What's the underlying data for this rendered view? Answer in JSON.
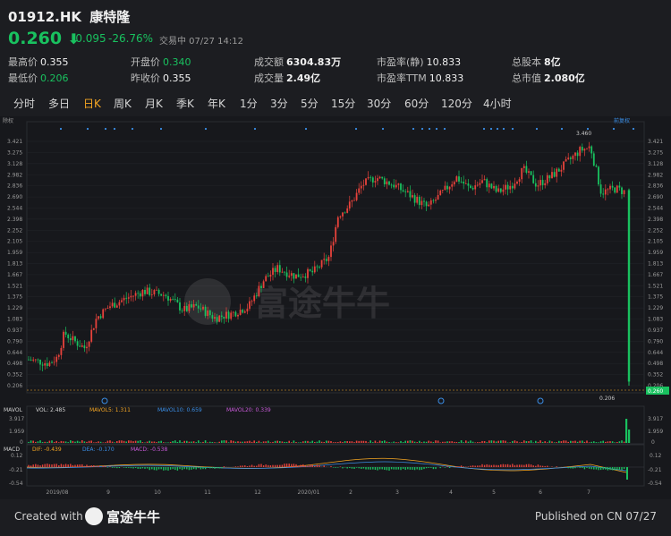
{
  "header": {
    "symbol": "01912.HK",
    "name": "康特隆",
    "price": "0.260",
    "change": "-0.095",
    "change_pct": "-26.76%",
    "status": "交易中 07/27 14:12",
    "colors": {
      "down": "#19c15f",
      "up": "#e8423b",
      "accent": "#f5a623"
    }
  },
  "stats": [
    {
      "label": "最高价",
      "value": "0.355"
    },
    {
      "label": "开盘价",
      "value": "0.340"
    },
    {
      "label": "成交额",
      "value": "6304.83万"
    },
    {
      "label": "市盈率(静)",
      "value": "10.833"
    },
    {
      "label": "总股本",
      "value": "8亿"
    },
    {
      "label": "最低价",
      "value": "0.206"
    },
    {
      "label": "昨收价",
      "value": "0.355"
    },
    {
      "label": "成交量",
      "value": "2.49亿"
    },
    {
      "label": "市盈率TTM",
      "value": "10.833"
    },
    {
      "label": "总市值",
      "value": "2.080亿"
    }
  ],
  "tabs": [
    "分时",
    "多日",
    "日K",
    "周K",
    "月K",
    "季K",
    "年K",
    "1分",
    "3分",
    "5分",
    "15分",
    "30分",
    "60分",
    "120分",
    "4小时"
  ],
  "active_tab": "日K",
  "chart": {
    "top_left_label": "除权",
    "top_right_label": "前复权",
    "y_ticks": [
      "3.421",
      "3.275",
      "3.128",
      "2.982",
      "2.836",
      "2.690",
      "2.544",
      "2.398",
      "2.252",
      "2.105",
      "1.959",
      "1.813",
      "1.667",
      "1.521",
      "1.375",
      "1.229",
      "1.083",
      "0.937",
      "0.790",
      "0.644",
      "0.498",
      "0.352",
      "0.206"
    ],
    "high_label": "3.460",
    "low_label": "0.206",
    "current_price_label": "0.260",
    "watermark": "富途牛牛",
    "vol_labels": [
      "MAVOL",
      "VOL: 2.485",
      "MAVOL5: 1.311",
      "MAVOL10: 0.659",
      "MAVOL20: 0.339"
    ],
    "vol_ticks": [
      "3.917",
      "1.959",
      "0"
    ],
    "macd_labels": [
      "MACD",
      "DIF: -0.439",
      "DEA: -0.170",
      "MACD: -0.538"
    ],
    "macd_ticks": [
      "0.12",
      "-0.21",
      "-0.54"
    ],
    "x_ticks": [
      "2019/08",
      "9",
      "10",
      "11",
      "12",
      "2020/01",
      "2",
      "3",
      "4",
      "5",
      "6",
      "7"
    ]
  },
  "chart_data": {
    "type": "candlestick",
    "title": "",
    "ylim": [
      0.206,
      3.46
    ],
    "x": [
      "2019/08",
      "9",
      "10",
      "11",
      "12",
      "2020/01",
      "2",
      "3",
      "4",
      "5",
      "6",
      "7"
    ],
    "close": [
      0.5,
      1.25,
      1.35,
      1.15,
      1.55,
      1.7,
      2.6,
      2.85,
      2.55,
      2.95,
      3.0,
      0.26
    ]
  },
  "footer": {
    "created_with": "Created with",
    "brand": "富途牛牛",
    "published": "Published on CN 07/27"
  }
}
